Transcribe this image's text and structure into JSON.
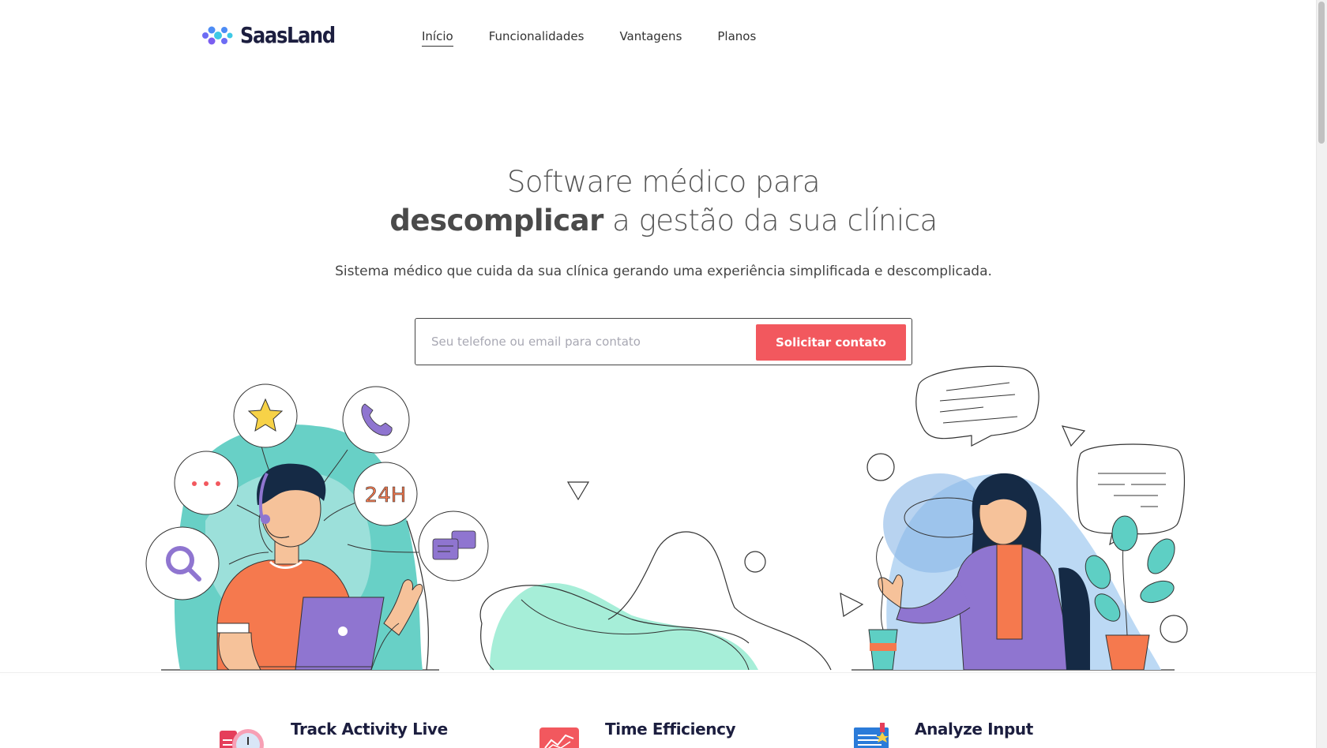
{
  "brand": {
    "name": "SaasLand",
    "logo_icon": "dots-cluster-logo-icon"
  },
  "nav": {
    "items": [
      {
        "label": "Início",
        "active": true
      },
      {
        "label": "Funcionalidades",
        "active": false
      },
      {
        "label": "Vantagens",
        "active": false
      },
      {
        "label": "Planos",
        "active": false
      }
    ]
  },
  "hero": {
    "title_line1": "Software médico para",
    "title_bold": "descomplicar",
    "title_line2_rest": " a gestão da sua clínica",
    "subtitle": "Sistema médico que cuida da sua clínica gerando uma experiência simplificada e descomplicada.",
    "input_placeholder": "Seu telefone ou email para contato",
    "button_label": "Solicitar contato",
    "badge_24h": "24H"
  },
  "features": [
    {
      "title": "Track Activity Live",
      "icon": "clock-report-icon"
    },
    {
      "title": "Time Efficiency",
      "icon": "chart-growth-icon"
    },
    {
      "title": "Analyze Input",
      "icon": "certificate-icon"
    }
  ],
  "colors": {
    "accent": "#f2585e",
    "teal": "#5ecfc4",
    "purple": "#8f75d0",
    "orange": "#f5794e",
    "navy": "#1c1e3f",
    "mint": "#a6eed8",
    "light_blue": "#bcd9f4"
  }
}
